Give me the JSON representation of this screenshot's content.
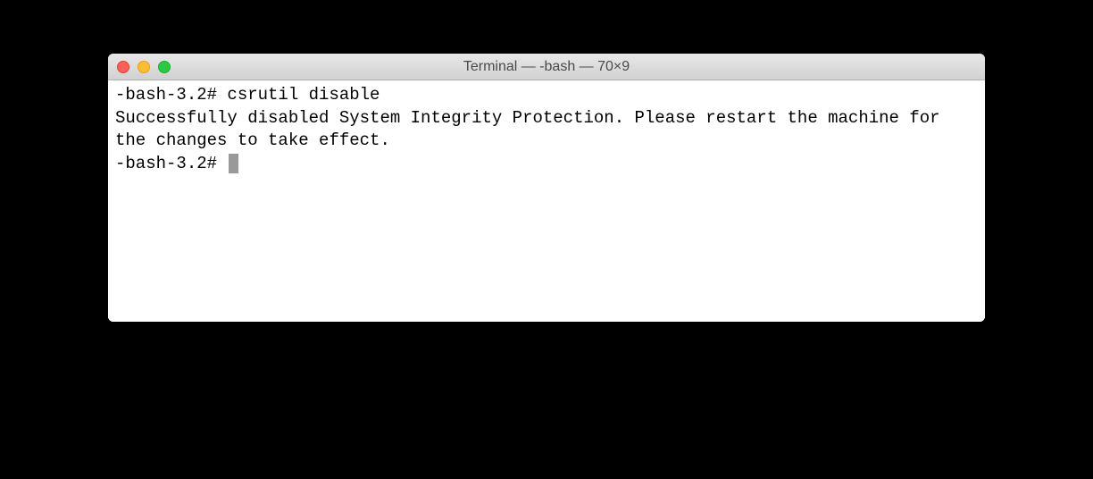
{
  "window": {
    "title": "Terminal — -bash — 70×9"
  },
  "terminal": {
    "lines": [
      "-bash-3.2# csrutil disable",
      "Successfully disabled System Integrity Protection. Please restart the machine for the changes to take effect.",
      "-bash-3.2# "
    ],
    "prompt_line1": "-bash-3.2# csrutil disable",
    "output_line": "Successfully disabled System Integrity Protection. Please restart the machine for the changes to take effect.",
    "prompt_line2": "-bash-3.2# "
  }
}
